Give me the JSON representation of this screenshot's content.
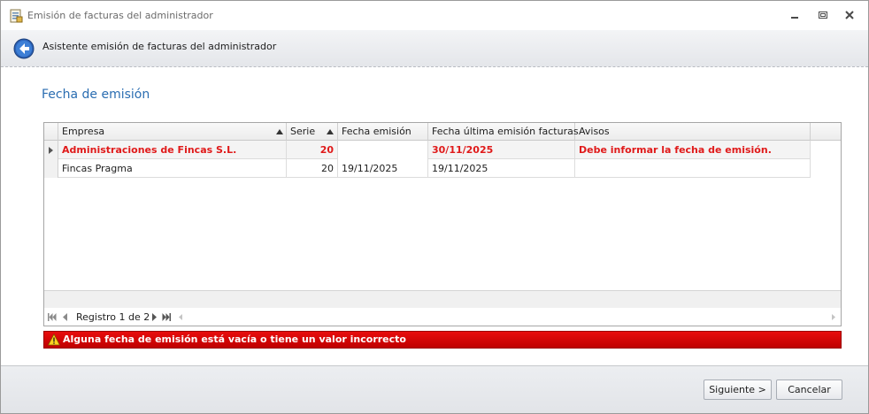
{
  "window": {
    "title": "Emisión de facturas del administrador"
  },
  "wizard": {
    "title": "Asistente emisión de facturas del administrador"
  },
  "section": {
    "title": "Fecha de emisión"
  },
  "grid": {
    "columns": [
      "Empresa",
      "Serie",
      "Fecha emisión",
      "Fecha última emisión facturas",
      "Avisos"
    ],
    "rows": [
      {
        "empresa": "Administraciones de Fincas S.L.",
        "serie": "20",
        "fecha_emision": "",
        "fecha_ultima": "30/11/2025",
        "avisos": "Debe informar la fecha de emisión."
      },
      {
        "empresa": "Fincas Pragma",
        "serie": "20",
        "fecha_emision": "19/11/2025",
        "fecha_ultima": "19/11/2025",
        "avisos": ""
      }
    ],
    "navigator": {
      "label": "Registro 1 de 2"
    }
  },
  "error": {
    "message": "Alguna fecha de emisión está vacía o tiene un valor incorrecto"
  },
  "buttons": {
    "next": "Siguiente >",
    "cancel": "Cancelar"
  },
  "colors": {
    "accent_title": "#2a6db1",
    "error_text": "#e01a1a",
    "error_bar": "#d40000"
  }
}
